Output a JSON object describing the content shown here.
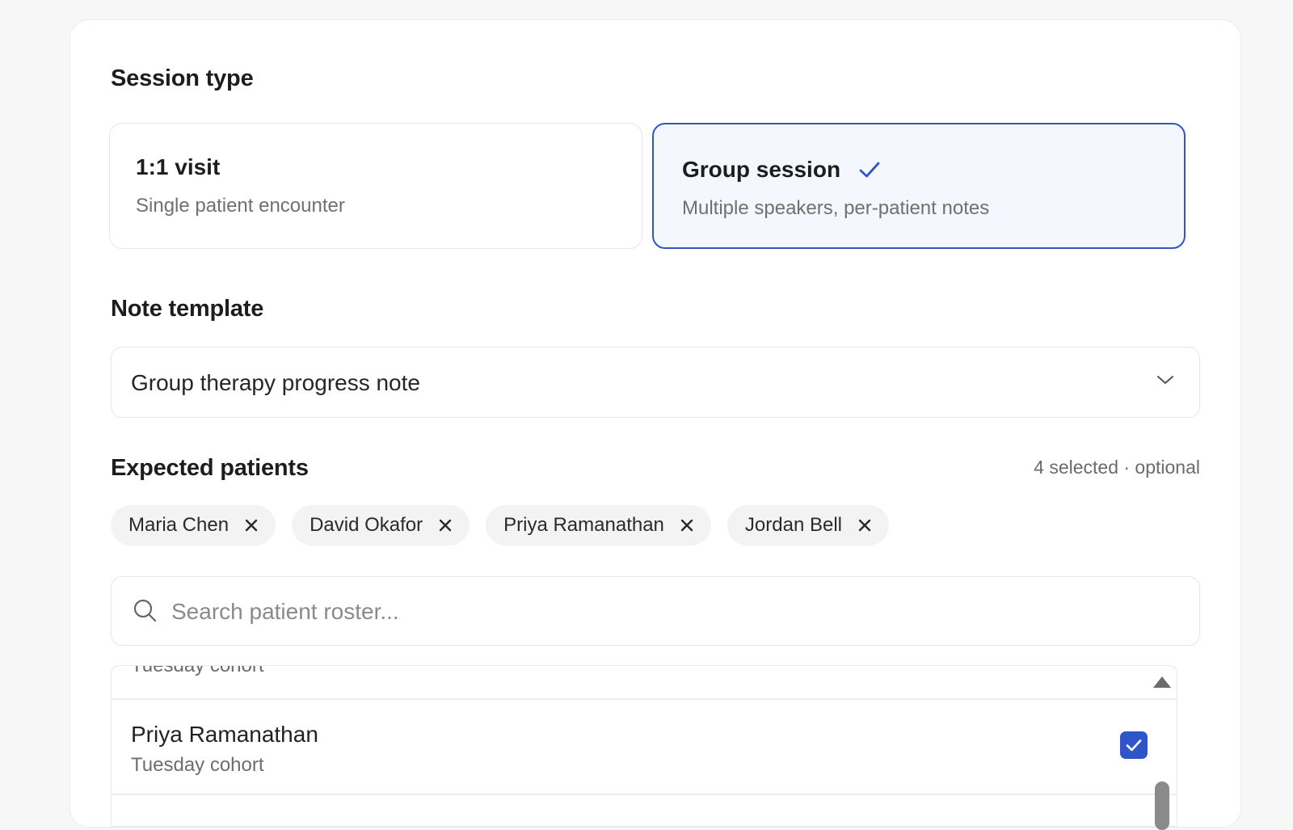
{
  "session_type": {
    "label": "Session type",
    "options": [
      {
        "title": "1:1 visit",
        "description": "Single patient encounter",
        "selected": false
      },
      {
        "title": "Group session",
        "description": "Multiple speakers, per-patient notes",
        "selected": true
      }
    ]
  },
  "note_template": {
    "label": "Note template",
    "value": "Group therapy progress note"
  },
  "expected_patients": {
    "label": "Expected patients",
    "meta": "4 selected · optional",
    "chips": [
      "Maria Chen",
      "David Okafor",
      "Priya Ramanathan",
      "Jordan Bell"
    ],
    "search_placeholder": "Search patient roster...",
    "roster": {
      "group_header": "Tuesday cohort",
      "rows": [
        {
          "name": "Priya Ramanathan",
          "cohort": "Tuesday cohort",
          "checked": true
        }
      ]
    }
  },
  "colors": {
    "accent": "#2f55c9",
    "selected_bg": "#f4f7fe"
  },
  "icons": {
    "selected_check": "check-icon",
    "dropdown": "chevron-down-icon",
    "remove_chip": "close-icon",
    "search": "search-icon",
    "checkbox": "checkbox-checked-icon"
  }
}
